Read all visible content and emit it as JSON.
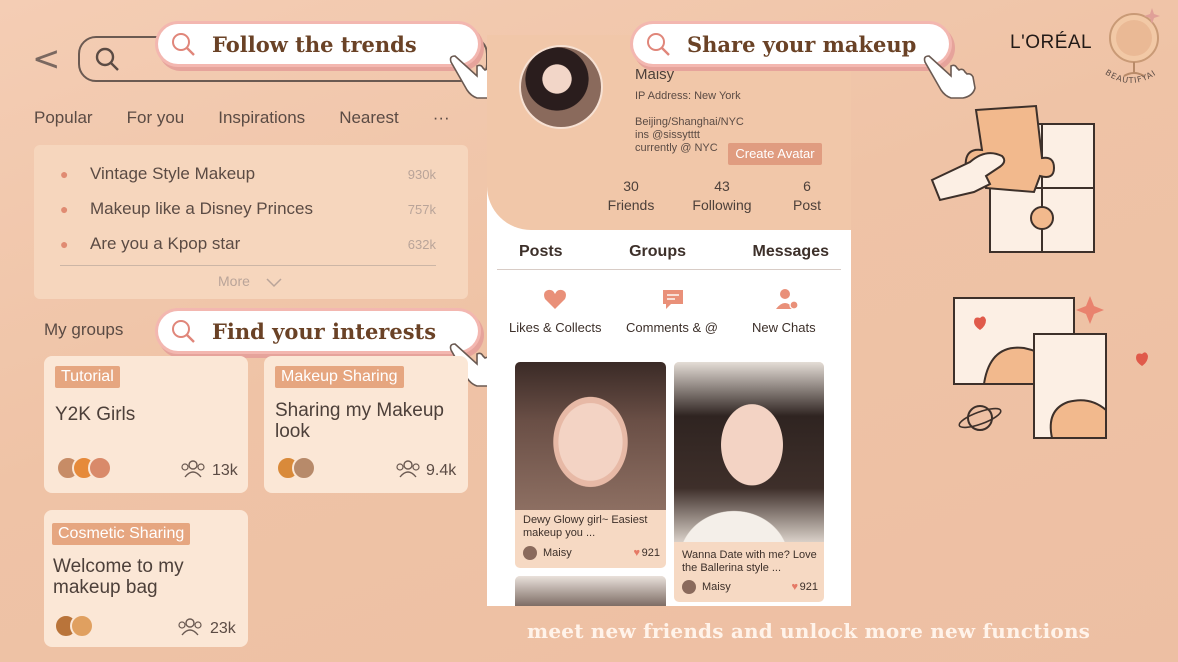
{
  "callouts": {
    "trends": "Follow the trends",
    "makeup": "Share your makeup",
    "interests": "Find your interests"
  },
  "nav": {
    "tabs": [
      "Popular",
      "For you",
      "Inspirations",
      "Nearest",
      "···"
    ]
  },
  "trending": {
    "items": [
      {
        "label": "Vintage Style Makeup",
        "count": "930k"
      },
      {
        "label": "Makeup like a Disney Princes",
        "count": "757k"
      },
      {
        "label": "Are you a Kpop star",
        "count": "632k"
      }
    ],
    "more": "More"
  },
  "groups": {
    "heading": "My groups",
    "cards": [
      {
        "tag": "Tutorial",
        "title": "Y2K Girls",
        "members": "13k"
      },
      {
        "tag": "Makeup Sharing",
        "title": "Sharing my Makeup look",
        "members": "9.4k"
      },
      {
        "tag": "Cosmetic Sharing",
        "title": "Welcome to my makeup bag",
        "members": "23k"
      }
    ]
  },
  "profile": {
    "name": "Maisy",
    "ip": "IP Address: New York",
    "location": "Beijing/Shanghai/NYC",
    "ins": "ins @sissytttt",
    "currently": "currently @ NYC",
    "create_avatar": "Create Avatar",
    "stats": [
      {
        "value": "30",
        "label": "Friends"
      },
      {
        "value": "43",
        "label": "Following"
      },
      {
        "value": "6",
        "label": "Post"
      }
    ],
    "tabs": [
      "Posts",
      "Groups",
      "Messages"
    ],
    "actions": [
      {
        "label": "Likes & Collects",
        "icon": "heart-icon"
      },
      {
        "label": "Comments & @",
        "icon": "comment-icon"
      },
      {
        "label": "New Chats",
        "icon": "user-icon"
      }
    ],
    "posts": [
      {
        "text": "Dewy Glowy girl~ Easiest makeup you ...",
        "user": "Maisy",
        "likes": "921"
      },
      {
        "text": "Wanna Date with me? Love the Ballerina style ...",
        "user": "Maisy",
        "likes": "921"
      }
    ]
  },
  "brand": {
    "name": "L'ORÉAL",
    "sub": "BEAUTIFYAI"
  },
  "footer": "meet new friends and unlock more new functions",
  "colors": {
    "accent": "#e09c80",
    "callout_border": "#f3b7b0",
    "heart": "#e57a66"
  }
}
